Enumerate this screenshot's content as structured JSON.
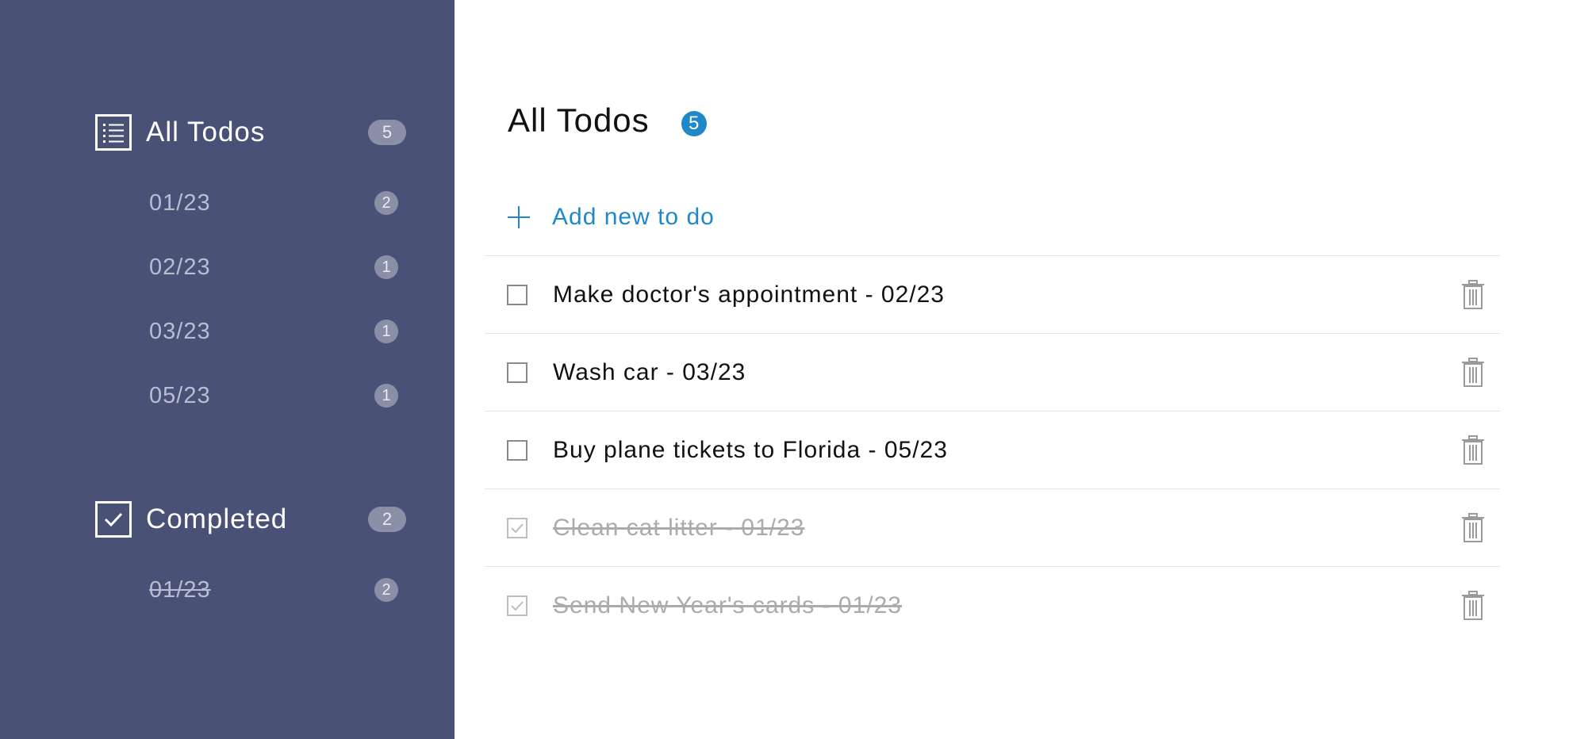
{
  "sidebar": {
    "all": {
      "label": "All Todos",
      "count": "5",
      "icon": "list-icon",
      "dates": [
        {
          "label": "01/23",
          "count": "2"
        },
        {
          "label": "02/23",
          "count": "1"
        },
        {
          "label": "03/23",
          "count": "1"
        },
        {
          "label": "05/23",
          "count": "1"
        }
      ]
    },
    "completed": {
      "label": "Completed",
      "count": "2",
      "icon": "checkbox-checked-icon",
      "dates": [
        {
          "label": "01/23",
          "count": "2"
        }
      ]
    }
  },
  "main": {
    "title": "All Todos",
    "count": "5",
    "add_label": "Add new to do",
    "todos": [
      {
        "text": "Make doctor's appointment - 02/23",
        "completed": false
      },
      {
        "text": "Wash car - 03/23",
        "completed": false
      },
      {
        "text": "Buy plane tickets to Florida - 05/23",
        "completed": false
      },
      {
        "text": "Clean cat litter - 01/23",
        "completed": true
      },
      {
        "text": "Send New Year's cards - 01/23",
        "completed": true
      }
    ]
  },
  "colors": {
    "sidebar_bg": "#4a5177",
    "accent": "#1e88c8",
    "badge_bg": "#8a8fa7",
    "completed_text": "#ababab"
  }
}
